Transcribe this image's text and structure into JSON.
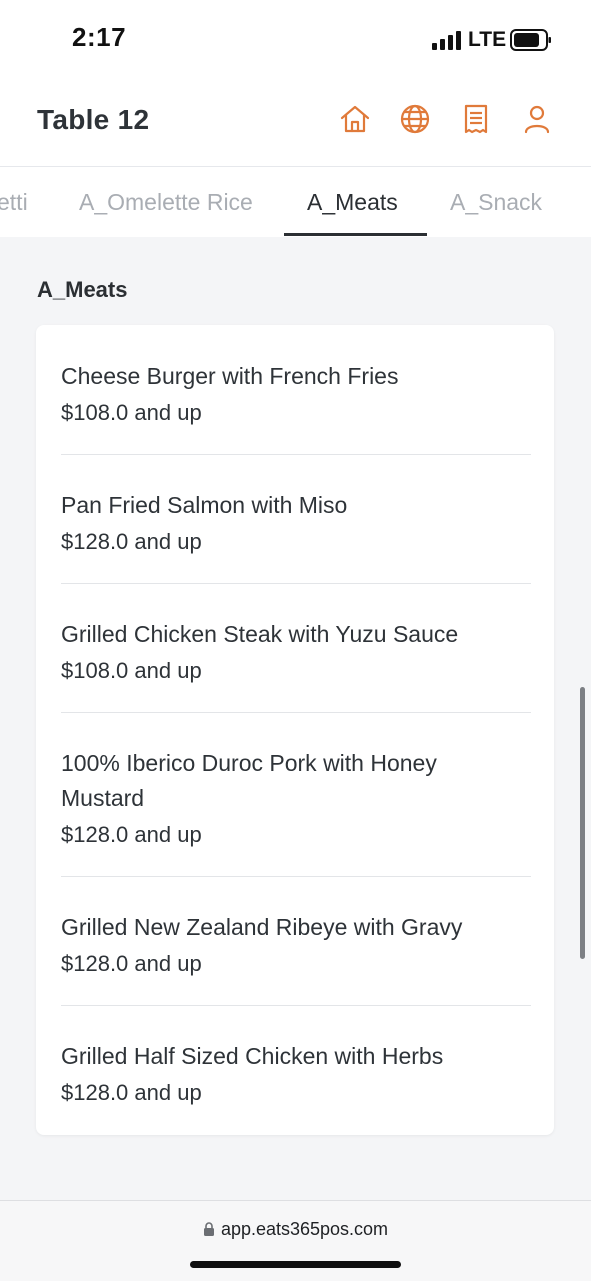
{
  "status_bar": {
    "time": "2:17",
    "network": "LTE"
  },
  "header": {
    "title": "Table 12",
    "icons": [
      "home-icon",
      "globe-icon",
      "receipt-icon",
      "user-icon"
    ],
    "accent_color": "#e07a3a"
  },
  "tabs": [
    {
      "label": "A_Spaghetti",
      "visible_text": "etti",
      "active": false
    },
    {
      "label": "A_Omelette Rice",
      "active": false
    },
    {
      "label": "A_Meats",
      "active": true
    },
    {
      "label": "A_Snack",
      "active": false
    }
  ],
  "section": {
    "title": "A_Meats",
    "items": [
      {
        "name": "Cheese Burger with French Fries",
        "price": "$108.0 and up"
      },
      {
        "name": "Pan Fried Salmon with Miso",
        "price": "$128.0 and up"
      },
      {
        "name": "Grilled Chicken Steak with Yuzu Sauce",
        "price": "$108.0 and up"
      },
      {
        "name": "100% Iberico Duroc Pork with Honey Mustard",
        "price": "$128.0 and up"
      },
      {
        "name": "Grilled New Zealand Ribeye with Gravy",
        "price": "$128.0 and up"
      },
      {
        "name": "Grilled Half Sized Chicken with Herbs",
        "price": "$128.0 and up"
      }
    ]
  },
  "browser": {
    "url": "app.eats365pos.com"
  }
}
